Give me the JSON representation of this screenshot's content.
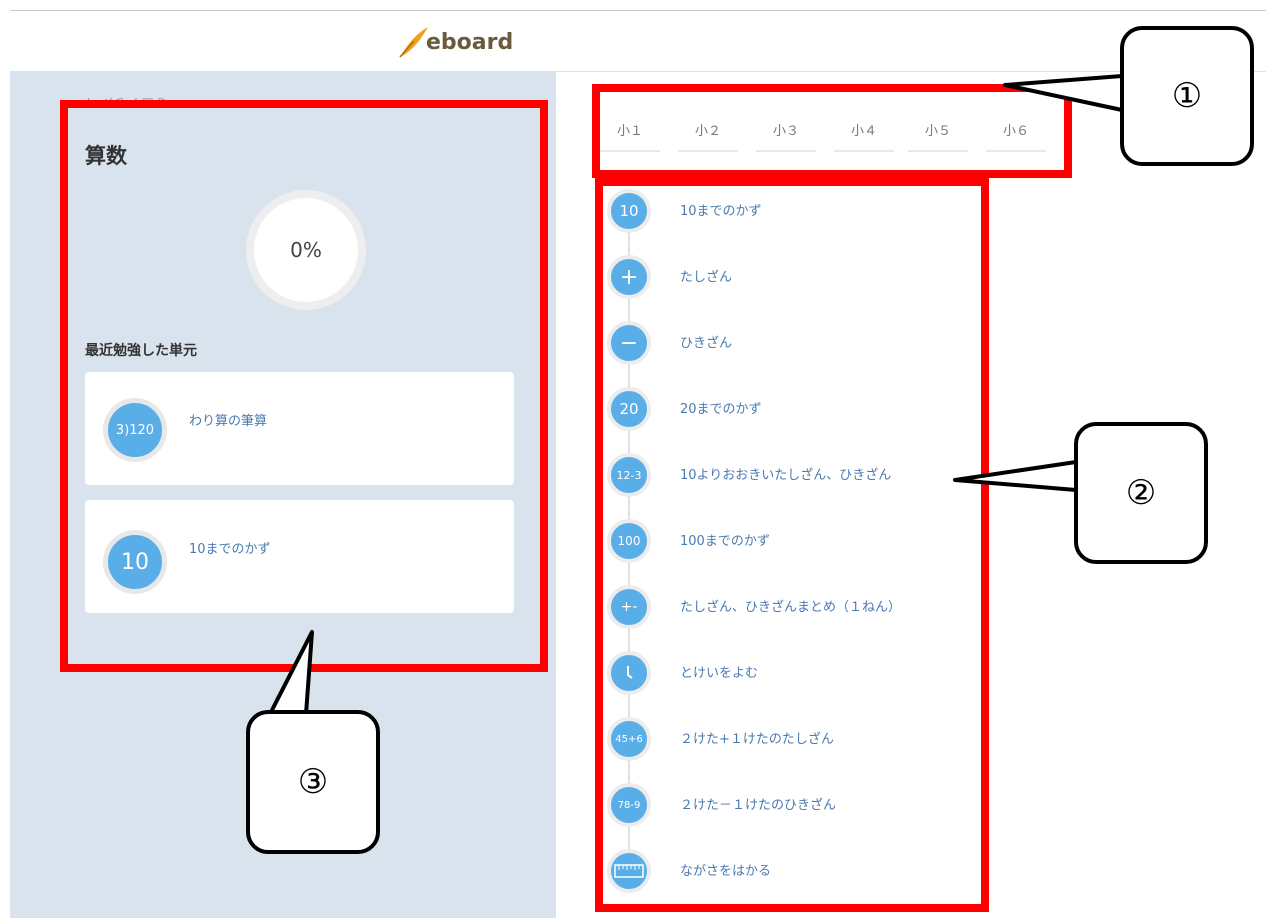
{
  "header": {
    "logo_text": "eboard"
  },
  "sidebar": {
    "back_link": "く マイノート",
    "subject": "算数",
    "progress": "0%",
    "recent_heading": "最近勉強した単元",
    "recent": [
      {
        "icon": "3)120",
        "label": "わり算の筆算"
      },
      {
        "icon": "10",
        "label": "10までのかず"
      }
    ]
  },
  "grades": [
    "小１",
    "小２",
    "小３",
    "小４",
    "小５",
    "小６"
  ],
  "units": [
    {
      "icon": "10",
      "label": "10までのかず"
    },
    {
      "icon": "+",
      "label": "たしざん"
    },
    {
      "icon": "−",
      "label": "ひきざん"
    },
    {
      "icon": "20",
      "label": "20までのかず"
    },
    {
      "icon": "12-3",
      "label": "10よりおおきいたしざん、ひきざん"
    },
    {
      "icon": "100",
      "label": "100までのかず"
    },
    {
      "icon": "+-",
      "label": "たしざん、ひきざんまとめ（１ねん）"
    },
    {
      "icon": "clock-icon",
      "label": "とけいをよむ"
    },
    {
      "icon": "45+6",
      "label": "２けた+１けたのたしざん"
    },
    {
      "icon": "78-9",
      "label": "２けた－１けたのひきざん"
    },
    {
      "icon": "ruler-icon",
      "label": "ながさをはかる"
    }
  ],
  "annotations": {
    "callout1": "①",
    "callout2": "②",
    "callout3": "③"
  },
  "colors": {
    "accent": "#5aaee8",
    "highlight": "#ff0000",
    "panel": "#d8e3ee"
  }
}
